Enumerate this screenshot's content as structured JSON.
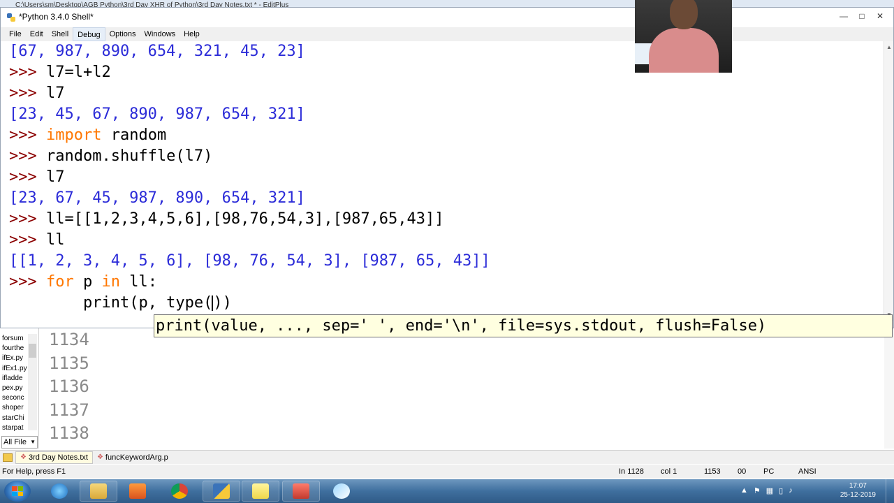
{
  "editplus": {
    "title": "C:\\Users\\sm\\Desktop\\AGB Python\\3rd Day XHR of Python\\3rd Day Notes.txt * - EditPlus",
    "files": [
      "forsum",
      "fourthe",
      "ifEx.py",
      "ifEx1.py",
      "ifladde",
      "pex.py",
      "seconc",
      "shoper",
      "starChi",
      "starpat"
    ],
    "filter": "All File",
    "line_numbers": [
      "1134",
      "1135",
      "1136",
      "1137",
      "1138"
    ],
    "tabs": [
      {
        "label": "3rd Day Notes.txt",
        "active": true
      },
      {
        "label": "funcKeywordArg.p",
        "active": false
      }
    ],
    "status": {
      "help": "For Help, press F1",
      "line": "In 1128",
      "col": "col 1",
      "total": "1153",
      "code": "00",
      "mode": "PC",
      "encoding": "ANSI"
    }
  },
  "idle": {
    "title": "*Python 3.4.0 Shell*",
    "menu": [
      "File",
      "Edit",
      "Shell",
      "Debug",
      "Options",
      "Windows",
      "Help"
    ],
    "active_menu": "Debug",
    "lines": [
      {
        "prompt": "",
        "kw": "",
        "text": "[67, 987, 890, 654, 321, 45, 23]",
        "type": "out"
      },
      {
        "prompt": ">>> ",
        "kw": "",
        "text": "l7=l+l2",
        "type": "in"
      },
      {
        "prompt": ">>> ",
        "kw": "",
        "text": "l7",
        "type": "in"
      },
      {
        "prompt": "",
        "kw": "",
        "text": "[23, 45, 67, 890, 987, 654, 321]",
        "type": "out"
      },
      {
        "prompt": ">>> ",
        "kw": "import",
        "text": " random",
        "type": "in"
      },
      {
        "prompt": ">>> ",
        "kw": "",
        "text": "random.shuffle(l7)",
        "type": "in"
      },
      {
        "prompt": ">>> ",
        "kw": "",
        "text": "l7",
        "type": "in"
      },
      {
        "prompt": "",
        "kw": "",
        "text": "[23, 67, 45, 987, 890, 654, 321]",
        "type": "out"
      },
      {
        "prompt": ">>> ",
        "kw": "",
        "text": "ll=[[1,2,3,4,5,6],[98,76,54,3],[987,65,43]]",
        "type": "in"
      },
      {
        "prompt": ">>> ",
        "kw": "",
        "text": "ll",
        "type": "in"
      },
      {
        "prompt": "",
        "kw": "",
        "text": "[[1, 2, 3, 4, 5, 6], [98, 76, 54, 3], [987, 65, 43]]",
        "type": "out"
      }
    ],
    "for_line": {
      "prompt": ">>> ",
      "kw1": "for",
      "mid1": " p ",
      "kw2": "in",
      "rest": " ll:"
    },
    "current_input": {
      "indent": "        ",
      "before_cursor": "print(p, type(",
      "after_cursor": "))"
    },
    "calltip": "print(value, ..., sep=' ', end='\\n', file=sys.stdout, flush=False)"
  },
  "taskbar": {
    "clock_time": "17:07",
    "clock_date": "25-12-2019",
    "items": [
      "windows-explorer",
      "internet-explorer",
      "file-manager",
      "media-player",
      "chrome",
      "python-idle",
      "sticky-notes",
      "editplus",
      "paint"
    ]
  },
  "colors": {
    "output": "#2b2bd8",
    "prompt": "#8b0000",
    "keyword": "#ff7700",
    "calltip_bg": "#ffffe0"
  }
}
